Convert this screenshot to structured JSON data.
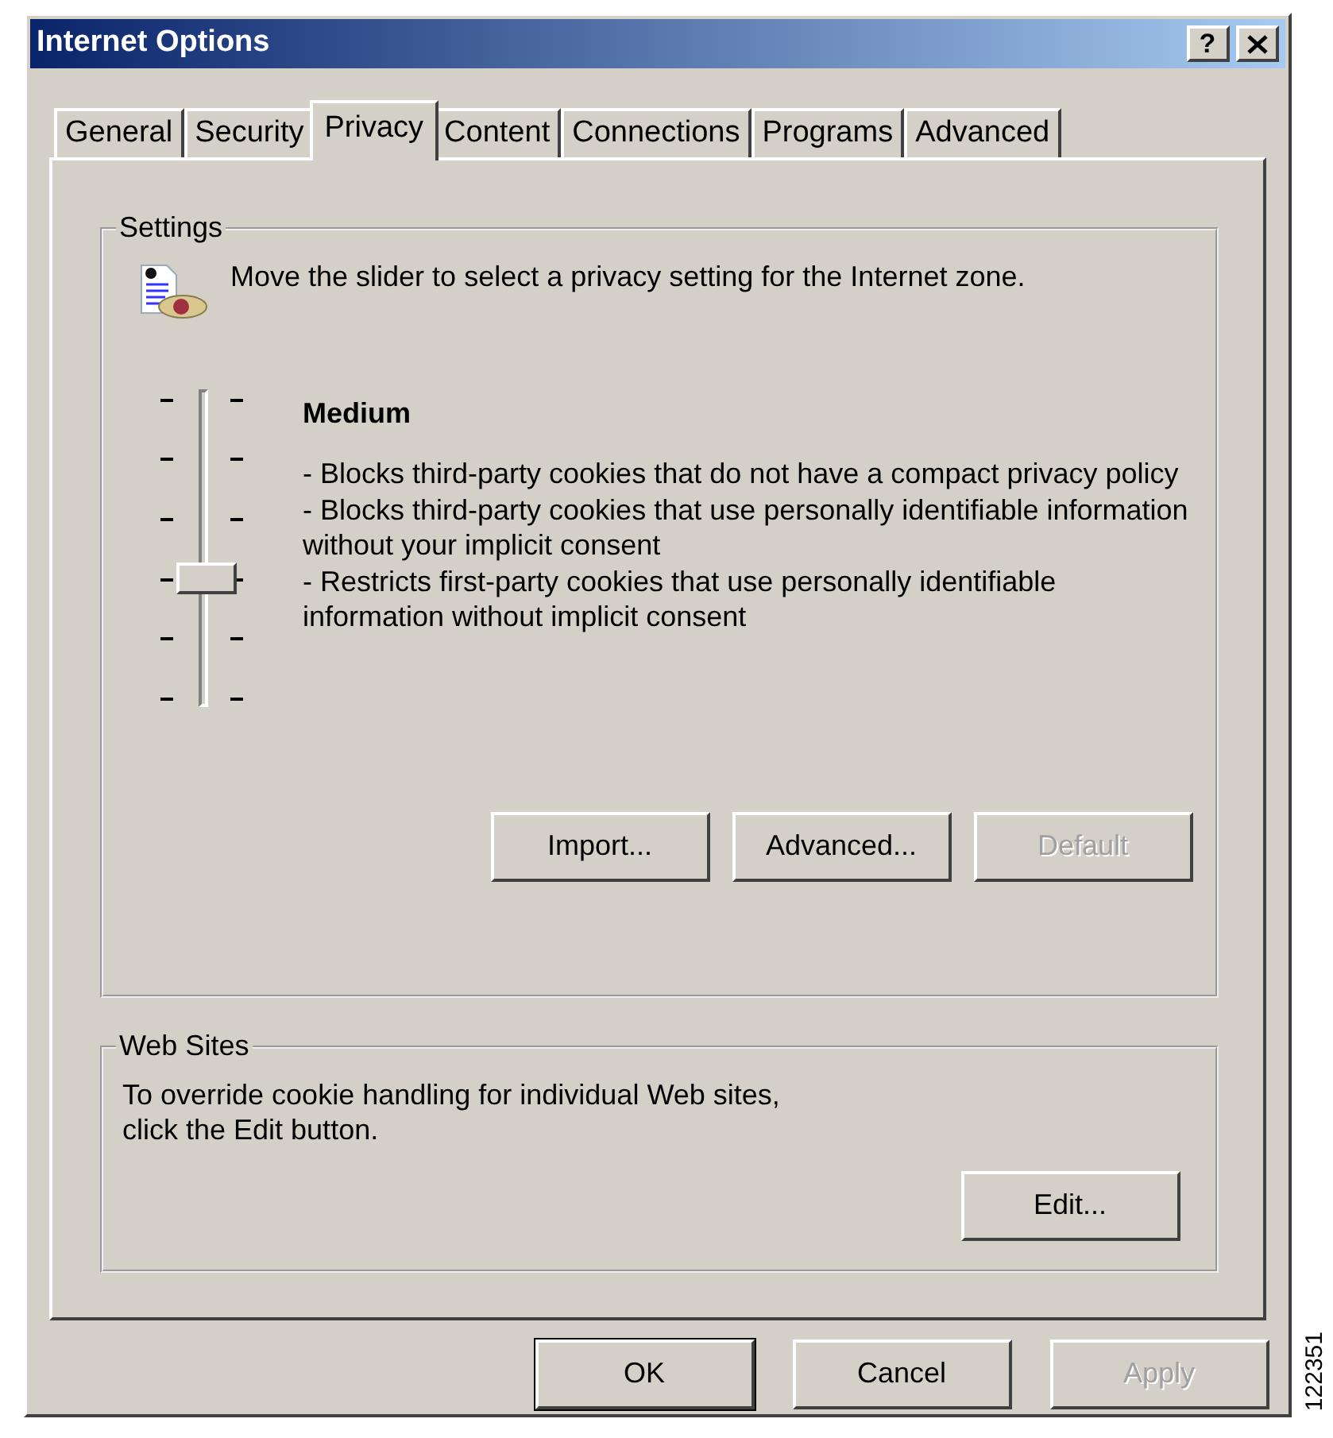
{
  "window": {
    "title": "Internet Options",
    "help": "?"
  },
  "tabs": [
    {
      "label": "General",
      "selected": false
    },
    {
      "label": "Security",
      "selected": false
    },
    {
      "label": "Privacy",
      "selected": true
    },
    {
      "label": "Content",
      "selected": false
    },
    {
      "label": "Connections",
      "selected": false
    },
    {
      "label": "Programs",
      "selected": false
    },
    {
      "label": "Advanced",
      "selected": false
    }
  ],
  "settings": {
    "legend": "Settings",
    "intro": "Move the slider to select a privacy setting for the Internet zone.",
    "slider": {
      "level": 0.4
    },
    "level_name": "Medium",
    "description": [
      "- Blocks third-party cookies that do not have a compact privacy policy",
      "- Blocks third-party cookies that use personally identifiable information without your implicit consent",
      "- Restricts first-party cookies that use personally identifiable information without implicit consent"
    ],
    "buttons": [
      {
        "label": "Import...",
        "disabled": false
      },
      {
        "label": "Advanced...",
        "disabled": false
      },
      {
        "label": "Default",
        "disabled": true
      }
    ]
  },
  "web_sites": {
    "legend": "Web Sites",
    "text": "To override cookie handling for individual Web sites, click the Edit button.",
    "button": {
      "label": "Edit...",
      "disabled": false
    }
  },
  "buttons": [
    {
      "label": "OK",
      "disabled": false,
      "default": true
    },
    {
      "label": "Cancel",
      "disabled": false,
      "default": false
    },
    {
      "label": "Apply",
      "disabled": true,
      "default": false
    }
  ],
  "figure_number": "122351"
}
